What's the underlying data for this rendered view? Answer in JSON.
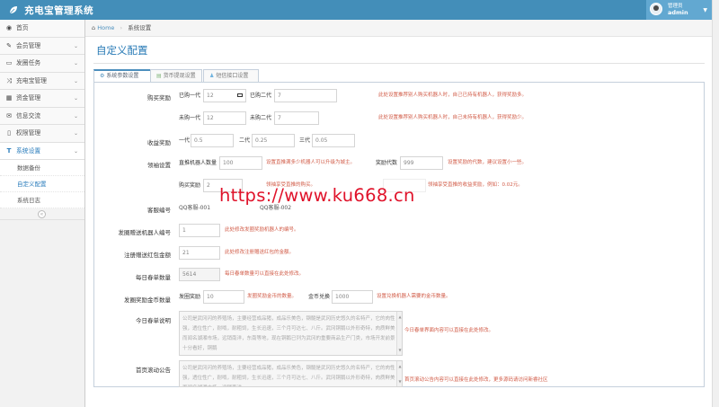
{
  "app": {
    "title": "充电宝管理系统"
  },
  "user": {
    "role": "管理员",
    "name": "admin"
  },
  "sidebar": {
    "items": [
      {
        "label": "首页",
        "icon": "tachometer-icon"
      },
      {
        "label": "会员管理",
        "icon": "edit-icon"
      },
      {
        "label": "发圈任务",
        "icon": "folder-icon"
      },
      {
        "label": "充电宝管理",
        "icon": "shuffle-icon"
      },
      {
        "label": "资金管理",
        "icon": "calendar-icon"
      },
      {
        "label": "信息交流",
        "icon": "mail-icon"
      },
      {
        "label": "权限管理",
        "icon": "file-icon"
      },
      {
        "label": "系统设置",
        "icon": "text-icon"
      }
    ],
    "sub_items": [
      "数据备份",
      "自定义配置",
      "系统日志"
    ]
  },
  "breadcrumb": {
    "home": "Home",
    "current": "系统设置"
  },
  "page": {
    "title": "自定义配置"
  },
  "tabs": [
    "系统参数设置",
    "货币提现设置",
    "短信接口设置"
  ],
  "form": {
    "buy_reward": {
      "label": "购买奖励",
      "r1": {
        "a_label": "已购一代",
        "a_value": "12",
        "b_label": "已购二代",
        "b_value": "7",
        "hint": "此处设置推荐别人购买机器人时，自己已持有机器人，获得奖励多。"
      },
      "r2": {
        "a_label": "未购一代",
        "a_value": "12",
        "b_label": "未购二代",
        "b_value": "7",
        "hint": "此处设置推荐别人购买机器人时，自己未持有机器人，获得奖励少。"
      }
    },
    "income_reward": {
      "label": "收益奖励",
      "g1_label": "一代",
      "g1": "0.5",
      "g2_label": "二代",
      "g2": "0.25",
      "g3_label": "三代",
      "g3": "0.05"
    },
    "leader": {
      "label": "领袖设置",
      "robots_label": "直推机器人数量",
      "robots": "100",
      "hint1": "设置直推满多少机器人可以升级为城主。",
      "gen_label": "奖励代数",
      "gen": "999",
      "hint2": "设置奖励的代数，建议设置小一些。",
      "buy_label": "购买奖励",
      "buy": "2",
      "hint3": "领袖享受直推的购买。",
      "hint4": "领袖享受直推的收益奖励，例如：0.02元。"
    },
    "customer": {
      "label": "客服编号",
      "v1": "QQ客服-001",
      "v2": "QQ客服-002"
    },
    "robot_id": {
      "label": "发圈赠送机器人编号",
      "value": "1",
      "hint": "此处修改发圈奖励机器人的编号。"
    },
    "red_packet": {
      "label": "注册赠送红包金额",
      "value": "21",
      "hint": "此处修改注册赠送红包的金额。"
    },
    "daily_orders": {
      "label": "每日春单数量",
      "value": "5614",
      "hint": "每日春单数量可以直接在此处修改。"
    },
    "coin": {
      "label": "发圈奖励金币数量",
      "reward_label": "发圈奖励",
      "reward": "10",
      "hint1": "发圈奖励金币的数量。",
      "exchange_label": "金币兑换",
      "exchange": "1000",
      "hint2": "设置兑换机器人需要的金币数量。"
    },
    "today_desc": {
      "label": "今日春单说明",
      "text": "公司是武冈闪的养殖场，主要经营成品猪，成品乐美色，钢髓是武冈历史悠久的名特产，它的肉性强，透位性广，耐啃，耐粗饲，生长迅速，三个月可达七、八斤。武冈铜鹅以外形奇特，肉质鲜美而闻名湖湘市场，远销南洋，东南等地，现在铜鹅已列为武冈的重要商品生产门类，市场开发前景十分看好，铜鹅",
      "hint": "今日春单界面内容可以直接在此处修改。"
    },
    "scroll_notice": {
      "label": "首页滚动公告",
      "text": "公司是武冈闪的养殖场，主要经营成品猪，成品乐美色，钢髓是武冈历史悠久的名特产，它的肉性强，透位性广，耐啃，耐粗饲，生长迅速，三个月可达七、八斤。武冈铜鹅以外形奇特，肉质鲜美而闻名湖湘市场，远销南洋",
      "hint": "首页滚动公告内容可以直接在此处修改，更多源码请访问新睿社区"
    }
  },
  "watermark": "https://www.ku668.cn",
  "colors": {
    "header": "#438eb9",
    "accent": "#2679b5",
    "hint": "#d15b47",
    "watermark": "#e0122a"
  }
}
